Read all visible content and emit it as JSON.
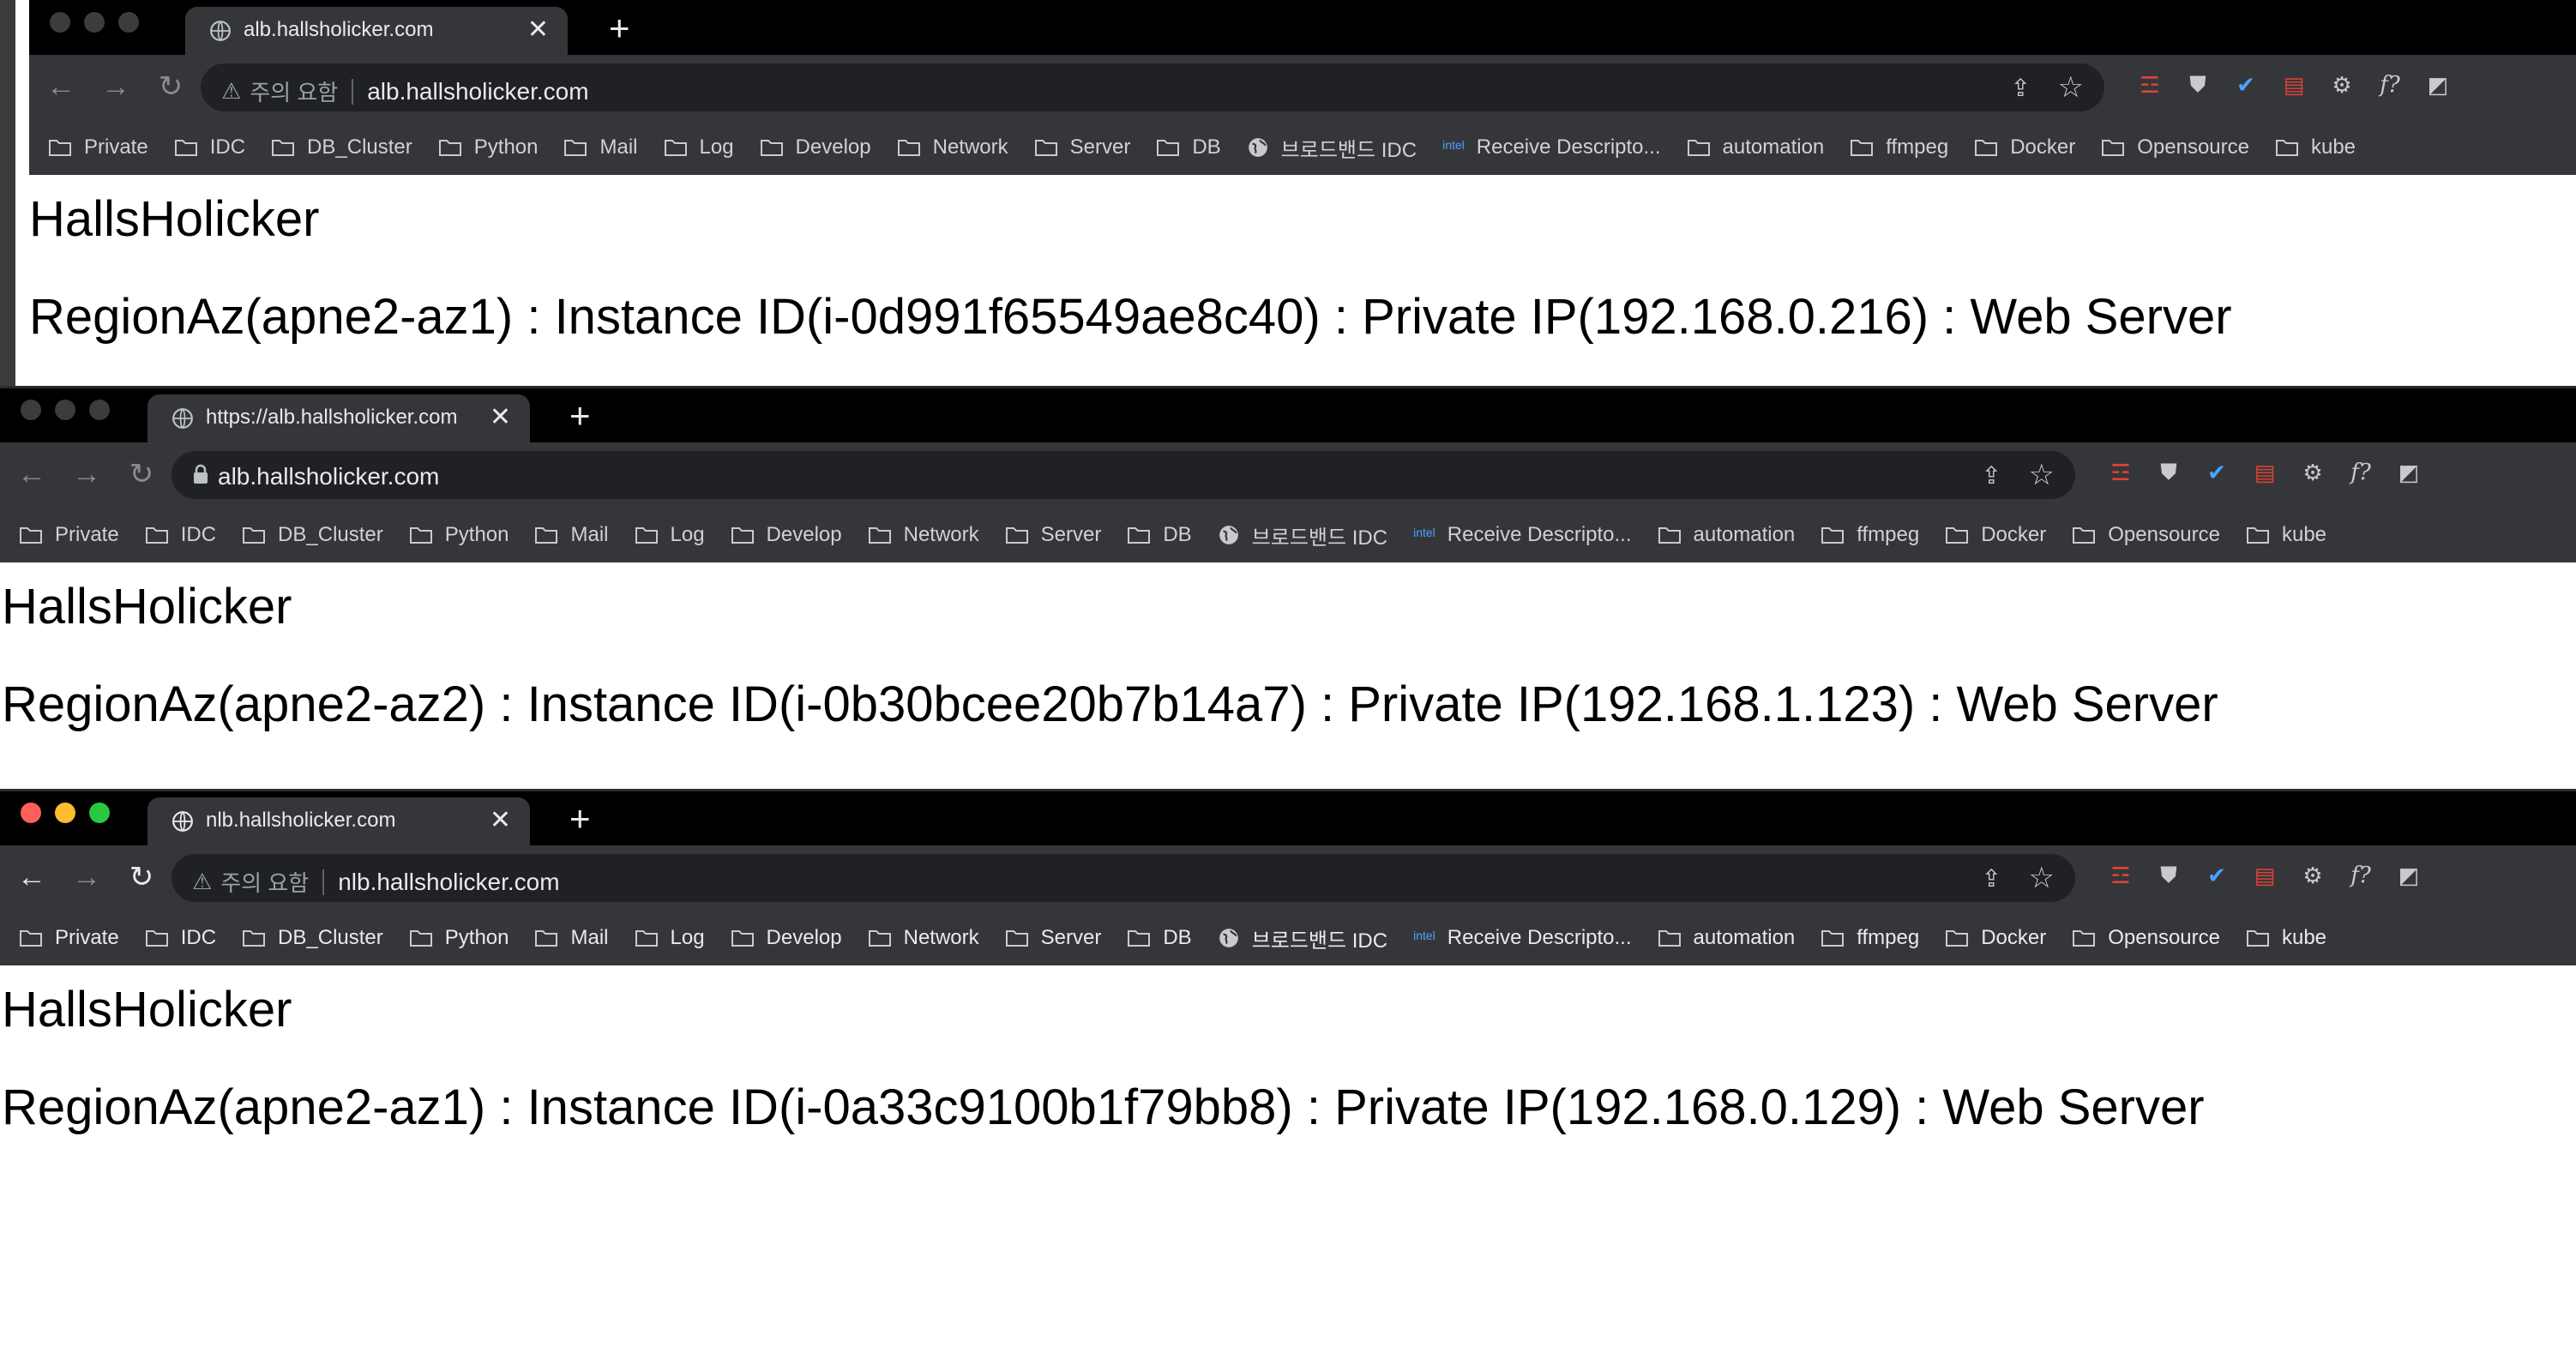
{
  "windows": [
    {
      "tab_title": "alb.hallsholicker.com",
      "new_tab_label": "+",
      "close_label": "✕",
      "security_label": "주의 요함",
      "address": "alb.hallsholicker.com",
      "page_title": "HallsHolicker",
      "page_info": "RegionAz(apne2-az1) : Instance ID(i-0d991f65549ae8c40) : Private IP(192.168.0.216) : Web Server"
    },
    {
      "tab_title": "https://alb.hallsholicker.com",
      "new_tab_label": "+",
      "close_label": "✕",
      "security_label": "",
      "address": "alb.hallsholicker.com",
      "page_title": "HallsHolicker",
      "page_info": "RegionAz(apne2-az2) : Instance ID(i-0b30bcee20b7b14a7) : Private IP(192.168.1.123) : Web Server"
    },
    {
      "tab_title": "nlb.hallsholicker.com",
      "new_tab_label": "+",
      "close_label": "✕",
      "security_label": "주의 요함",
      "address": "nlb.hallsholicker.com",
      "page_title": "HallsHolicker",
      "page_info": "RegionAz(apne2-az1) : Instance ID(i-0a33c9100b1f79bb8) : Private IP(192.168.0.129) : Web Server"
    }
  ],
  "bookmarks": [
    {
      "label": "Private",
      "icon": "folder-icon"
    },
    {
      "label": "IDC",
      "icon": "folder-icon"
    },
    {
      "label": "DB_Cluster",
      "icon": "folder-icon"
    },
    {
      "label": "Python",
      "icon": "folder-icon"
    },
    {
      "label": "Mail",
      "icon": "folder-icon"
    },
    {
      "label": "Log",
      "icon": "folder-icon"
    },
    {
      "label": "Develop",
      "icon": "folder-icon"
    },
    {
      "label": "Network",
      "icon": "folder-icon"
    },
    {
      "label": "Server",
      "icon": "folder-icon"
    },
    {
      "label": "DB",
      "icon": "folder-icon"
    },
    {
      "label": "브로드밴드 IDC",
      "icon": "globe-icon"
    },
    {
      "label": "Receive Descripto...",
      "icon": "intel-icon",
      "icon_text": "intel"
    },
    {
      "label": "automation",
      "icon": "folder-icon"
    },
    {
      "label": "ffmpeg",
      "icon": "folder-icon"
    },
    {
      "label": "Docker",
      "icon": "folder-icon"
    },
    {
      "label": "Opensource",
      "icon": "folder-icon"
    },
    {
      "label": "kube",
      "icon": "folder-icon"
    }
  ],
  "extensions": [
    {
      "name": "record-icon",
      "glyph": "☲"
    },
    {
      "name": "shield-icon",
      "glyph": "⛊"
    },
    {
      "name": "vpn-icon",
      "glyph": "✔"
    },
    {
      "name": "screenshot-icon",
      "glyph": "▤"
    },
    {
      "name": "gear-icon",
      "glyph": "⚙"
    },
    {
      "name": "formula-icon",
      "glyph": "f?"
    },
    {
      "name": "bookmark-arrow-icon",
      "glyph": "◩"
    }
  ],
  "colors": {
    "tabbar": "#000000",
    "toolbar": "#35363a",
    "omnibox": "#202124",
    "text_light": "#e8eaed",
    "mac_red": "#ff5f57",
    "mac_yellow": "#febc2e",
    "mac_green": "#28c840"
  }
}
